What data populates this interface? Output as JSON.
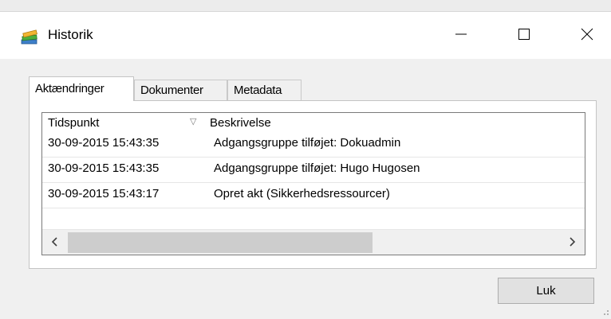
{
  "window": {
    "title": "Historik",
    "icon": "books-icon",
    "controls": [
      "minimize-icon",
      "maximize-icon",
      "close-icon"
    ]
  },
  "tabs": [
    {
      "label": "Aktændringer",
      "active": true
    },
    {
      "label": "Dokumenter",
      "active": false
    },
    {
      "label": "Metadata",
      "active": false
    }
  ],
  "list": {
    "columns": [
      "Tidspunkt",
      "Beskrivelse"
    ],
    "sort_indicator": "▽",
    "rows": [
      {
        "time": "30-09-2015 15:43:35",
        "description": "Adgangsgruppe tilføjet: Dokuadmin"
      },
      {
        "time": "30-09-2015 15:43:35",
        "description": "Adgangsgruppe tilføjet: Hugo Hugosen"
      },
      {
        "time": "30-09-2015 15:43:17",
        "description": "Opret akt (Sikkerhedsressourcer)"
      }
    ]
  },
  "buttons": {
    "close_label": "Luk"
  }
}
